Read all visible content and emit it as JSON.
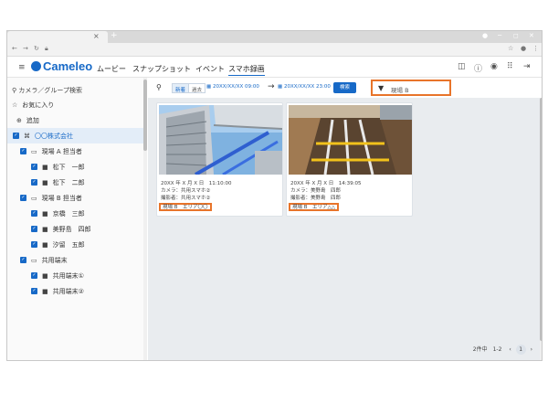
{
  "browser": {
    "tab_close": "×",
    "tab_new": "+",
    "window_controls": [
      "●",
      "─",
      "◻",
      "✕"
    ]
  },
  "app": {
    "logo": "Cameleo",
    "nav": [
      "ムービー",
      "スナップショット",
      "イベント",
      "スマホ録画"
    ],
    "active_nav": "スマホ録画",
    "accent_color": "#1769c7",
    "highlight_color": "#e8742a"
  },
  "sidebar": {
    "search_placeholder": "カメラ／グループ検索",
    "favorites": "お気に入り",
    "add": "追加",
    "org": "〇〇株式会社",
    "tree": [
      {
        "label": "現場 A 担当者",
        "type": "group",
        "level": 1
      },
      {
        "label": "松下　一郎",
        "type": "camera",
        "level": 2
      },
      {
        "label": "松下　二郎",
        "type": "camera",
        "level": 2
      },
      {
        "label": "現場 B 担当者",
        "type": "group",
        "level": 1
      },
      {
        "label": "京橋　三郎",
        "type": "camera",
        "level": 2
      },
      {
        "label": "美野島　四郎",
        "type": "camera",
        "level": 2
      },
      {
        "label": "汐留　五郎",
        "type": "camera",
        "level": 2
      },
      {
        "label": "共用端末",
        "type": "group",
        "level": 1
      },
      {
        "label": "共用端末①",
        "type": "camera",
        "level": 2
      },
      {
        "label": "共用端末②",
        "type": "camera",
        "level": 2
      }
    ]
  },
  "filter": {
    "sort_new": "新着",
    "sort_old": "過去",
    "date_from": "20XX/XX/XX 09:00",
    "date_to": "20XX/XX/XX 23:00",
    "search_button": "検索",
    "field_value": "現場 B"
  },
  "cards": [
    {
      "date": "20XX 年 X 月 X 日　11:10:00",
      "camera": "カメラ：共用スマホ②",
      "photographer": "撮影者：共用スマホ②",
      "location": "現場 B　エリア〇〇"
    },
    {
      "date": "20XX 年 X 月 X 日　14:39:05",
      "camera": "カメラ：美野島　四郎",
      "photographer": "撮影者：美野島　四郎",
      "location": "現場 B　エリア△△"
    }
  ],
  "pagination": {
    "summary": "2件中　1-2",
    "prev": "‹",
    "current": "1",
    "next": "›"
  }
}
